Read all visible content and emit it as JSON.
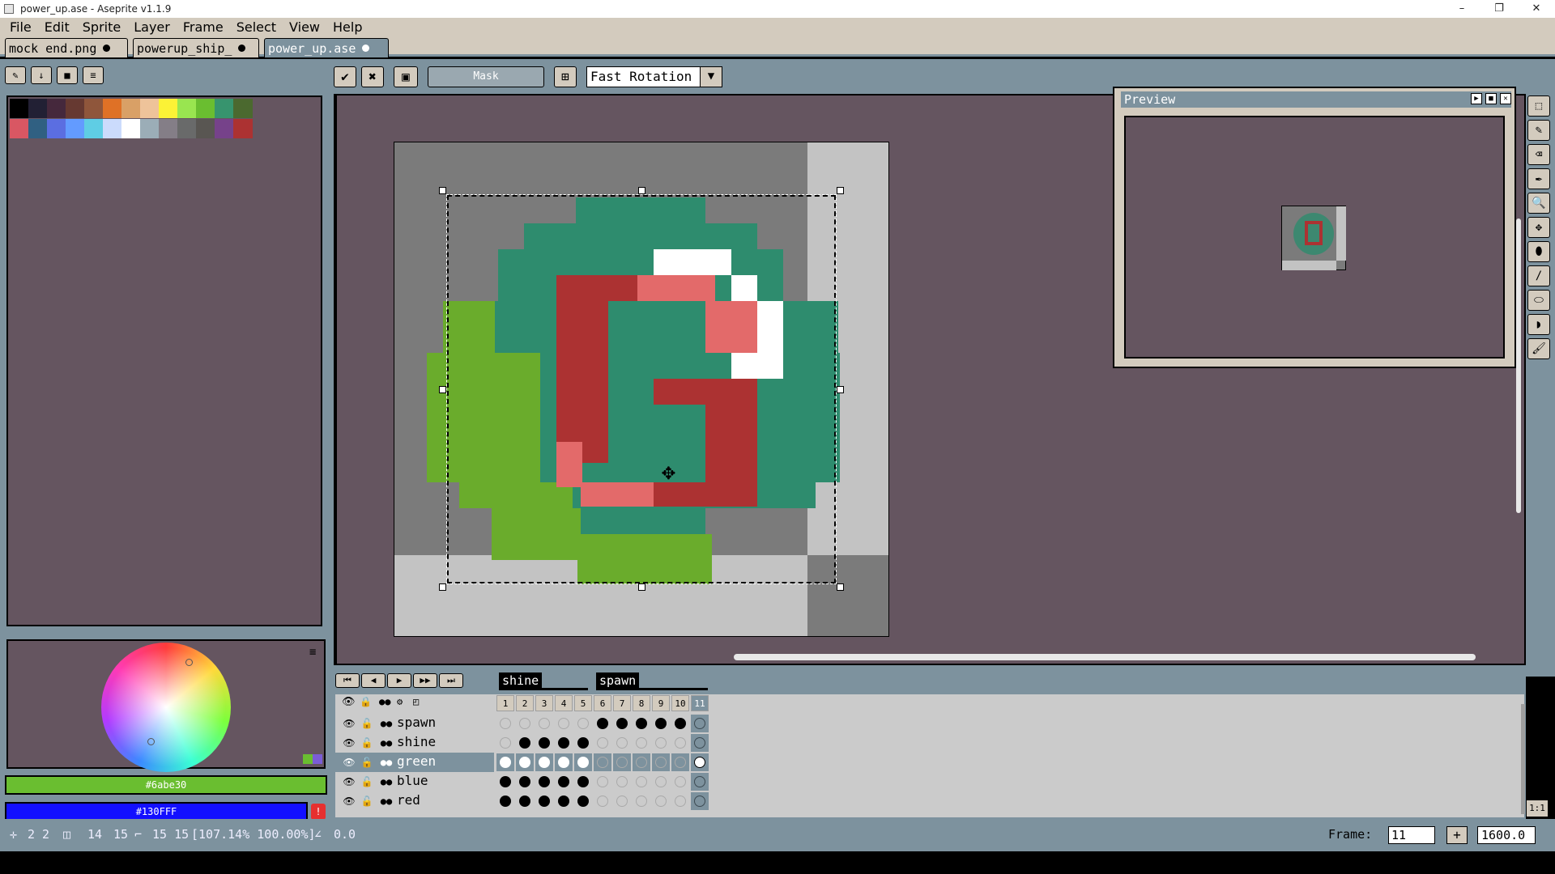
{
  "window": {
    "title": "power_up.ase - Aseprite v1.1.9",
    "controls": {
      "minimize": "–",
      "maximize": "❐",
      "close": "✕"
    }
  },
  "menu": [
    "File",
    "Edit",
    "Sprite",
    "Layer",
    "Frame",
    "Select",
    "View",
    "Help"
  ],
  "tabs": [
    {
      "label": "mock end.png",
      "active": false
    },
    {
      "label": "powerup_ship_",
      "active": false
    },
    {
      "label": "power_up.ase",
      "active": true
    }
  ],
  "palette_toolbar": {
    "edit_icon": "✎",
    "down_icon": "↓",
    "stop_icon": "■",
    "menu_icon": "≡"
  },
  "palette_colors": [
    "#000000",
    "#222034",
    "#45283c",
    "#663931",
    "#8f563b",
    "#df7126",
    "#d9a066",
    "#eec39a",
    "#fbf236",
    "#99e550",
    "#6abe30",
    "#37946e",
    "#4b692f",
    "#d95763",
    "#306082",
    "#5b6ee1",
    "#639bff",
    "#5fcde4",
    "#cbdbfc",
    "#ffffff",
    "#9badb7",
    "#847e87",
    "#696a6a",
    "#595652",
    "#76428a",
    "#ac3232"
  ],
  "colors": {
    "foreground": "#6abe30",
    "background": "#130FFF",
    "teal": "#2e8c6e",
    "green": "#6aac2c",
    "red": "#ac3232",
    "pink": "#e36a6a",
    "white": "#ffffff",
    "gray": "#7b7b7b",
    "lightgray": "#c3c3c3",
    "canvas_bg": "#655560"
  },
  "context_bar": {
    "ok_icon": "✔",
    "cancel_icon": "✖",
    "mask_label": "Mask",
    "rotation_algorithm": "Fast Rotation",
    "dropdown_icon": "▼"
  },
  "preview": {
    "title": "Preview"
  },
  "right_tools": [
    "⬚",
    "✎",
    "⌫",
    "✒",
    "🔍",
    "✥",
    "⬮",
    "/",
    "⬭",
    "◗",
    "🖌"
  ],
  "timeline": {
    "playback": [
      "⏮",
      "◀",
      "▶",
      "▶▶",
      "⏭"
    ],
    "tags": [
      {
        "name": "shine"
      },
      {
        "name": "spawn"
      }
    ],
    "frames": [
      "1",
      "2",
      "3",
      "4",
      "5",
      "6",
      "7",
      "8",
      "9",
      "10",
      "11"
    ],
    "layers": [
      {
        "name": "spawn",
        "cels": [
          0,
          0,
          0,
          0,
          0,
          1,
          1,
          1,
          1,
          1,
          2
        ]
      },
      {
        "name": "shine",
        "cels": [
          0,
          1,
          1,
          1,
          1,
          0,
          0,
          0,
          0,
          0,
          2
        ]
      },
      {
        "name": "green",
        "cels": [
          3,
          3,
          3,
          3,
          3,
          0,
          0,
          0,
          0,
          0,
          4
        ]
      },
      {
        "name": "blue",
        "cels": [
          1,
          1,
          1,
          1,
          1,
          0,
          0,
          0,
          0,
          0,
          2
        ]
      },
      {
        "name": "red",
        "cels": [
          1,
          1,
          1,
          1,
          1,
          0,
          0,
          0,
          0,
          0,
          2
        ]
      }
    ]
  },
  "status": {
    "pos": "2 2",
    "size_a": "14",
    "size_b": "15",
    "sel": "15 15",
    "scale": "[107.14% 100.00%]",
    "angle": "0.0",
    "frame_label": "Frame:",
    "frame_value": "11",
    "add_icon": "+",
    "zoom": "1600.0",
    "zoom_reset": "1:1"
  }
}
